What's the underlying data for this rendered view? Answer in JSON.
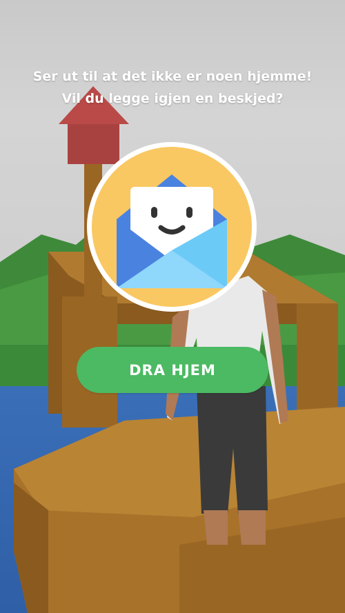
{
  "dialog": {
    "message_line1": "Ser ut til at det ikke er noen hjemme!",
    "message_line2": "Vil du legge igjen en beskjed?",
    "icon": "smiling-envelope-icon",
    "button_label": "DRA HJEM"
  },
  "colors": {
    "button": "#4cb963",
    "icon_circle": "#f9c863",
    "envelope_light": "#6ccaf7",
    "envelope_dark": "#4a82e0",
    "mailbox_red": "#b94a48",
    "wood": "#a8722a",
    "water": "#3a6fb8",
    "grass": "#3f8f3c"
  }
}
